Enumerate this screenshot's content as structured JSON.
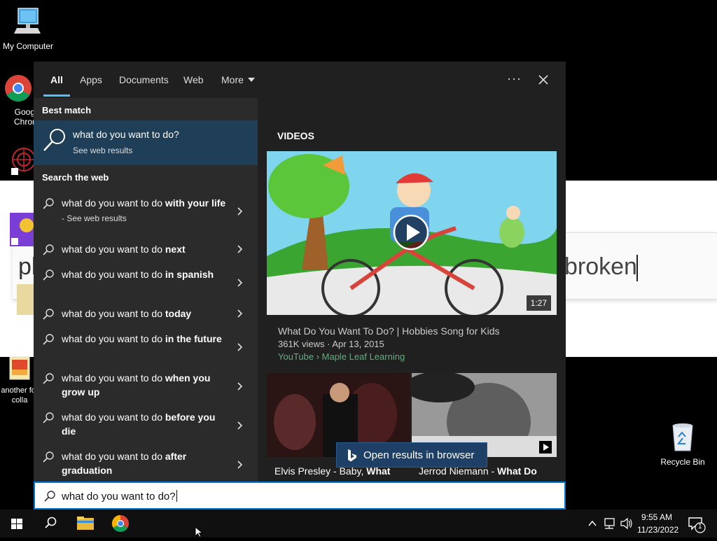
{
  "desktop": {
    "icons": [
      {
        "label": "My Computer"
      },
      {
        "label": "Goog Chror"
      },
      {
        "label": ""
      },
      {
        "label": ""
      },
      {
        "label": "another for colla"
      },
      {
        "label": "Recycle Bin"
      }
    ],
    "background_window": {
      "text_left": "pl",
      "text_right": "broken"
    }
  },
  "search_panel": {
    "tabs": [
      {
        "label": "All",
        "active": true
      },
      {
        "label": "Apps"
      },
      {
        "label": "Documents"
      },
      {
        "label": "Web"
      },
      {
        "label": "More"
      }
    ],
    "more_options_label": "···",
    "best_match": {
      "heading": "Best match",
      "title": "what do you want to do?",
      "subtitle": "See web results"
    },
    "search_the_web": {
      "heading": "Search the web",
      "items": [
        {
          "prefix": "what do you want to do ",
          "bold": "with your life",
          "suffix": " - See web results"
        },
        {
          "prefix": "what do you want to do ",
          "bold": "next",
          "suffix": ""
        },
        {
          "prefix": "what do you want to do ",
          "bold": "in spanish",
          "suffix": ""
        },
        {
          "prefix": "what do you want to do ",
          "bold": "today",
          "suffix": ""
        },
        {
          "prefix": "what do you want to do ",
          "bold": "in the future",
          "suffix": ""
        },
        {
          "prefix": "what do you want to do ",
          "bold": "when you grow up",
          "suffix": ""
        },
        {
          "prefix": "what do you want to do ",
          "bold": "before you die",
          "suffix": ""
        },
        {
          "prefix": "what do you want to do ",
          "bold": "after graduation",
          "suffix": ""
        }
      ]
    },
    "videos": {
      "heading": "VIDEOS",
      "main": {
        "duration": "1:27",
        "title": "What Do You Want To Do? | Hobbies Song for Kids",
        "meta": "361K views  ·  Apr 13, 2015",
        "source": "YouTube › Maple Leaf Learning"
      },
      "thumb1": {
        "title_prefix": "Elvis Presley - Baby, ",
        "title_bold": "What"
      },
      "thumb2": {
        "title_prefix": "Jerrod Niemann - ",
        "title_bold": "What Do"
      },
      "open_in_browser": "Open results in browser"
    }
  },
  "search_box": {
    "value": "what do you want to do?"
  },
  "taskbar": {
    "clock_time": "9:55 AM",
    "clock_date": "11/23/2022",
    "notification_count": "1"
  },
  "colors": {
    "accent": "#0078d4",
    "panel_bg": "#202020",
    "left_col_bg": "#2b2b2b",
    "selected_bg": "#1f3e58",
    "source_green": "#5fae7e"
  }
}
